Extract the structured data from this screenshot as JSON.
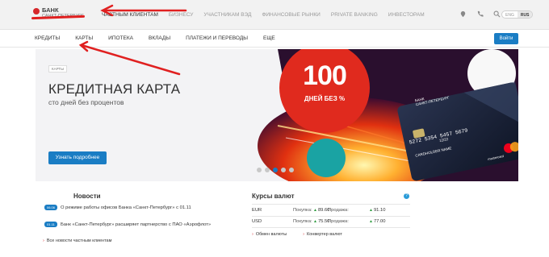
{
  "logo": {
    "line1": "БАНК",
    "line2": "САНКТ-ПЕТЕРБУРГ"
  },
  "segments": [
    "ЧАСТНЫМ КЛИЕНТАМ",
    "БИЗНЕСУ",
    "УЧАСТНИКАМ ВЭД",
    "ФИНАНСОВЫЕ РЫНКИ",
    "PRIVATE BANKING",
    "ИНВЕСТОРАМ"
  ],
  "lang": {
    "eng": "ENG",
    "rus": "RUS"
  },
  "nav": [
    "КРЕДИТЫ",
    "КАРТЫ",
    "ИПОТЕКА",
    "ВКЛАДЫ",
    "ПЛАТЕЖИ И ПЕРЕВОДЫ",
    "ЕЩЕ"
  ],
  "login_label": "Войти",
  "hero": {
    "tag": "КАРТЫ",
    "title": "КРЕДИТНАЯ КАРТА",
    "subtitle": "сто дней без процентов",
    "button": "Узнать подробнее",
    "badge_number": "100",
    "badge_text": "ДНЕЙ БЕЗ %",
    "card_bank1": "БАНК",
    "card_bank2": "САНКТ-ПЕТЕРБУРГ",
    "card_number": "5272 5354 5457 5679",
    "card_expiry": "12/22",
    "card_holder": "CARDHOLDER NAME",
    "card_brand": "mastercard"
  },
  "news": {
    "title": "Новости",
    "items": [
      {
        "date": "06.06",
        "text": "О режиме работы офисов Банка «Санкт-Петербург» с 01.11"
      },
      {
        "date": "01.11",
        "text": "Банк «Санкт-Петербург» расширяет партнерство с ПАО «Аэрофлот»"
      }
    ],
    "all_link": "Все новости частным клиентам"
  },
  "rates": {
    "title": "Курсы валют",
    "buy_label": "Покупка:",
    "sell_label": "Продажа:",
    "rows": [
      {
        "currency": "EUR",
        "buy": "89.60",
        "sell": "91.10"
      },
      {
        "currency": "USD",
        "buy": "75.50",
        "sell": "77.00"
      }
    ],
    "exchange_link": "Обмен валюты",
    "converter_link": "Конвертер валют"
  },
  "colors": {
    "accent": "#1a7dc4",
    "brand_red": "#d6282b",
    "annotation": "#e02020"
  }
}
